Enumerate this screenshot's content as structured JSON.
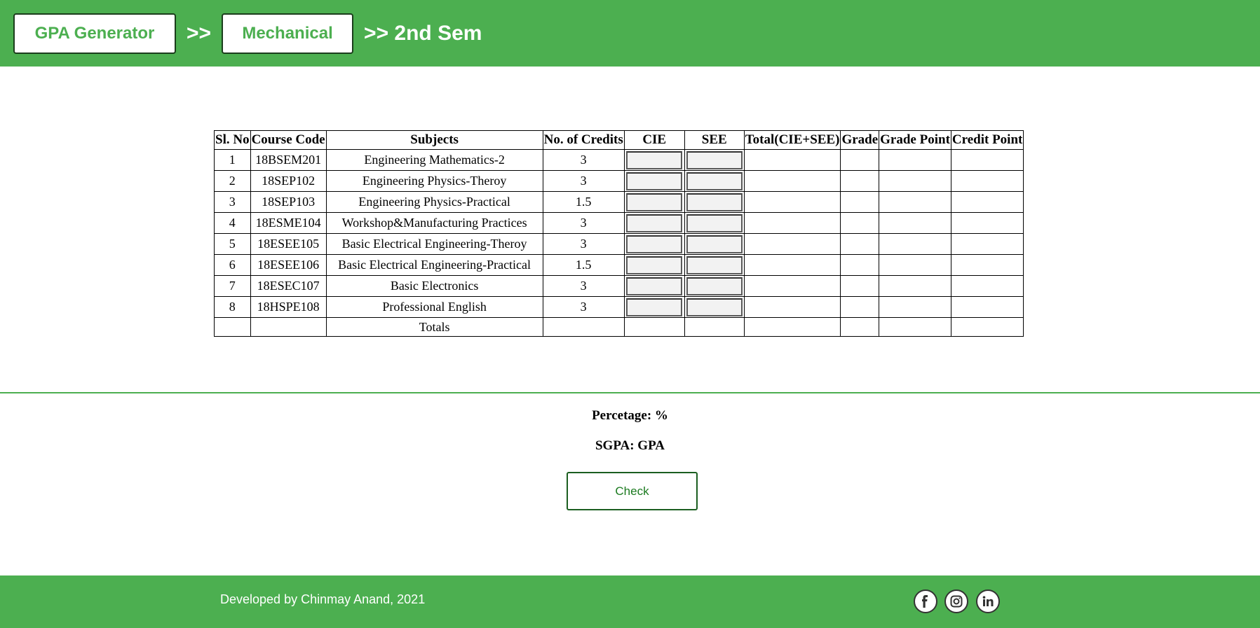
{
  "header": {
    "crumb1": "GPA Generator",
    "sep1": ">>",
    "crumb2": "Mechanical",
    "current": ">> 2nd Sem"
  },
  "table": {
    "headers": [
      "Sl. No",
      "Course Code",
      "Subjects",
      "No. of Credits",
      "CIE",
      "SEE",
      "Total(CIE+SEE)",
      "Grade",
      "Grade Point",
      "Credit Point"
    ],
    "rows": [
      {
        "sl": "1",
        "code": "18BSEM201",
        "subject": "Engineering Mathematics-2",
        "credits": "3"
      },
      {
        "sl": "2",
        "code": "18SEP102",
        "subject": "Engineering Physics-Theroy",
        "credits": "3"
      },
      {
        "sl": "3",
        "code": "18SEP103",
        "subject": "Engineering Physics-Practical",
        "credits": "1.5"
      },
      {
        "sl": "4",
        "code": "18ESME104",
        "subject": "Workshop&Manufacturing Practices",
        "credits": "3"
      },
      {
        "sl": "5",
        "code": "18ESEE105",
        "subject": "Basic Electrical Engineering-Theroy",
        "credits": "3"
      },
      {
        "sl": "6",
        "code": "18ESEE106",
        "subject": "Basic Electrical Engineering-Practical",
        "credits": "1.5"
      },
      {
        "sl": "7",
        "code": "18ESEC107",
        "subject": "Basic Electronics",
        "credits": "3"
      },
      {
        "sl": "8",
        "code": "18HSPE108",
        "subject": "Professional English",
        "credits": "3"
      }
    ],
    "totals_label": "Totals"
  },
  "results": {
    "percentage": "Percetage: %",
    "sgpa": "SGPA: GPA"
  },
  "check_label": "Check",
  "footer": {
    "text": "Developed by Chinmay Anand, 2021",
    "icons": [
      "facebook-icon",
      "instagram-icon",
      "linkedin-icon"
    ]
  },
  "colors": {
    "brand_green": "#4caf50",
    "dark_green": "#1b5e20"
  }
}
